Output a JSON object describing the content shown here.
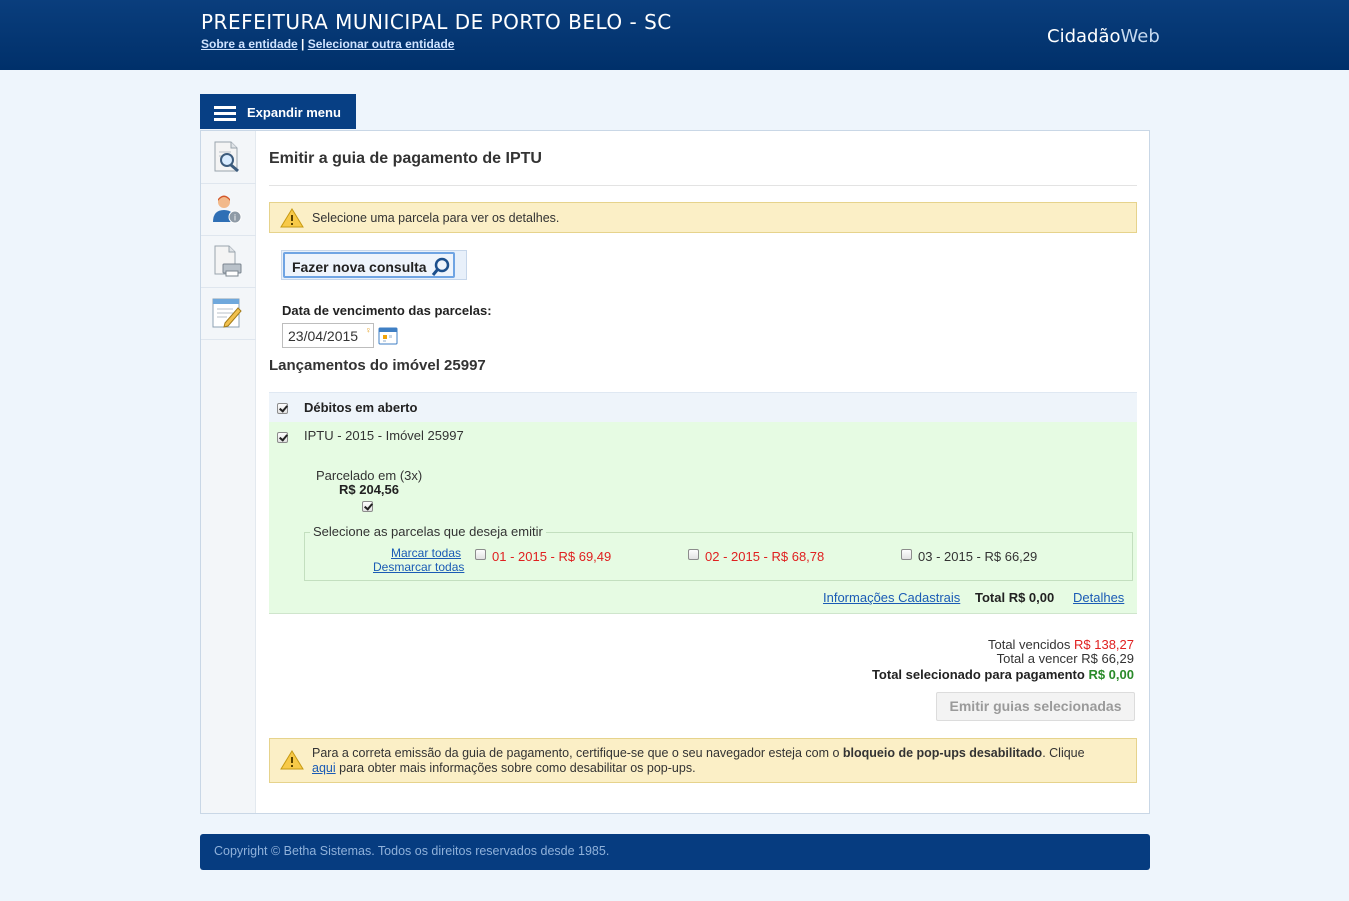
{
  "header": {
    "entity_title": "PREFEITURA MUNICIPAL DE PORTO BELO - SC",
    "link_about": "Sobre a entidade",
    "separator": "|",
    "link_select": "Selecionar outra entidade",
    "brand_part1": "Cidadão",
    "brand_part2": "Web"
  },
  "menu": {
    "expand_label": "Expandir menu",
    "side_icons": [
      "search-document-icon",
      "user-info-icon",
      "print-document-icon",
      "edit-form-icon"
    ]
  },
  "page": {
    "title": "Emitir a guia de pagamento de IPTU",
    "alert_top": "Selecione uma parcela para ver os detalhes.",
    "new_query_label": "Fazer nova consulta",
    "date_label": "Data de vencimento das parcelas:",
    "date_value": "23/04/2015",
    "section_title": "Lançamentos do imóvel 25997"
  },
  "grid": {
    "header_label": "Débitos em aberto",
    "row_title": "IPTU - 2015 - Imóvel 25997",
    "parcel_label": "Parcelado em (3x)",
    "parcel_value": "R$ 204,56",
    "installments_legend": "Selecione as parcelas que deseja emitir",
    "mark_all": "Marcar todas",
    "unmark_all": "Desmarcar todas",
    "installments": [
      {
        "label": "01 - 2015 - R$ 69,49",
        "overdue": true
      },
      {
        "label": "02 - 2015 - R$ 68,78",
        "overdue": true
      },
      {
        "label": "03 - 2015 - R$ 66,29",
        "overdue": false
      }
    ],
    "link_info": "Informações Cadastrais",
    "row_total": "Total R$ 0,00",
    "link_details": "Detalhes"
  },
  "totals": {
    "overdue_label": "Total vencidos",
    "overdue_value": "R$ 138,27",
    "due_label": "Total a vencer",
    "due_value": "R$ 66,29",
    "selected_label": "Total selecionado para pagamento",
    "selected_value": "R$ 0,00",
    "emit_button": "Emitir guias selecionadas"
  },
  "popup_notice": {
    "part1": "Para a correta emissão da guia de pagamento, certifique-se que o seu navegador esteja com o ",
    "bold": "bloqueio de pop-ups desabilitado",
    "part2": ". Clique",
    "link": "aqui",
    "part3": " para obter mais informações sobre como desabilitar os pop-ups."
  },
  "footer": {
    "copyright": "Copyright © Betha Sistemas. Todos os direitos reservados desde 1985."
  },
  "colors": {
    "header_blue": "#00306a",
    "overdue_red": "#e02020",
    "selected_green": "#2a8a2a",
    "row_green_bg": "#e6fbe3",
    "alert_yellow": "#fbefc6"
  }
}
